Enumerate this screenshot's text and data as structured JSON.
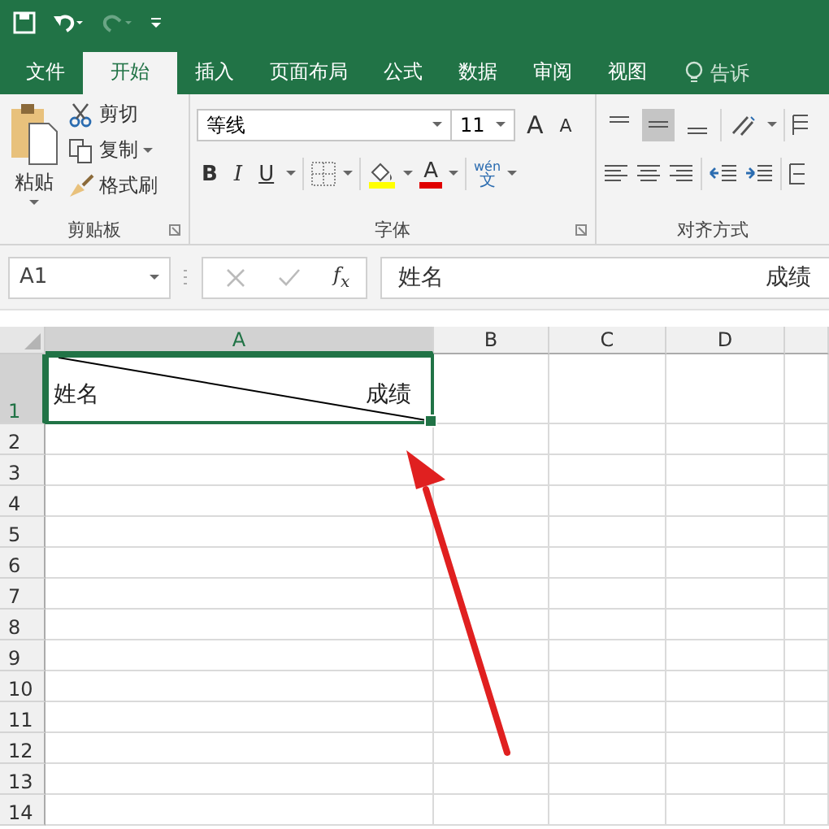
{
  "tabs": [
    {
      "label": "文件",
      "selected": false
    },
    {
      "label": "开始",
      "selected": true
    },
    {
      "label": "插入",
      "selected": false
    },
    {
      "label": "页面布局",
      "selected": false
    },
    {
      "label": "公式",
      "selected": false
    },
    {
      "label": "数据",
      "selected": false
    },
    {
      "label": "审阅",
      "selected": false
    },
    {
      "label": "视图",
      "selected": false
    }
  ],
  "tell_me": "告诉",
  "clipboard": {
    "paste": "粘贴",
    "cut": "剪切",
    "copy": "复制",
    "format_painter": "格式刷",
    "label": "剪贴板"
  },
  "font": {
    "name": "等线",
    "size": "11",
    "grow": "A",
    "shrink": "A",
    "bold": "B",
    "italic": "I",
    "underline": "U",
    "font_color": "A",
    "phonetic_top": "wén",
    "phonetic_bottom": "文",
    "label": "字体"
  },
  "alignment": {
    "vertical": [
      {
        "kind": "top",
        "selected": false
      },
      {
        "kind": "middle",
        "selected": true
      },
      {
        "kind": "bottom",
        "selected": false
      }
    ],
    "label": "对齐方式"
  },
  "name_box": "A1",
  "fx": "f$_{x}$",
  "formula": [
    "姓名",
    "成绩"
  ],
  "columns": [
    {
      "label": "A",
      "selected": true
    },
    {
      "label": "B",
      "selected": false
    },
    {
      "label": "C",
      "selected": false
    },
    {
      "label": "D",
      "selected": false
    }
  ],
  "rows": [
    {
      "label": "1",
      "selected": true
    },
    {
      "label": "2",
      "selected": false
    },
    {
      "label": "3",
      "selected": false
    },
    {
      "label": "4",
      "selected": false
    },
    {
      "label": "5",
      "selected": false
    },
    {
      "label": "6",
      "selected": false
    },
    {
      "label": "7",
      "selected": false
    },
    {
      "label": "8",
      "selected": false
    },
    {
      "label": "9",
      "selected": false
    },
    {
      "label": "10",
      "selected": false
    },
    {
      "label": "11",
      "selected": false
    },
    {
      "label": "12",
      "selected": false
    },
    {
      "label": "13",
      "selected": false
    },
    {
      "label": "14",
      "selected": false
    }
  ],
  "cell_a1": {
    "left": "姓名",
    "right": "成绩",
    "diagonal": true
  }
}
